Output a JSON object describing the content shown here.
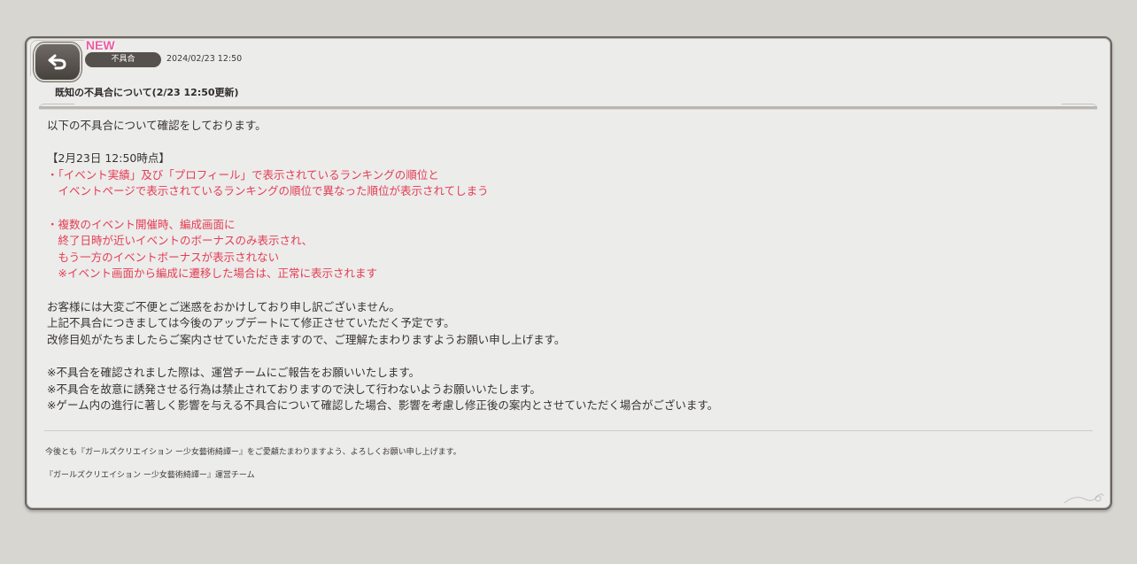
{
  "header": {
    "new_label": "NEW",
    "category": "不具合",
    "date": "2024/02/23 12:50",
    "title": "既知の不具合について(2/23 12:50更新)"
  },
  "icons": {
    "back": "back-arrow-icon"
  },
  "colors": {
    "accent_red": "#e33d52",
    "new_pink": "#ec5aa1",
    "pill_bg": "#56514d"
  },
  "body": {
    "intro": "以下の不具合について確認をしております。",
    "section_heading": "【2月23日 12:50時点】",
    "issue1_line1": "・「イベント実績」及び「プロフィール」で表示されているランキングの順位と",
    "issue1_line2": "　イベントページで表示されているランキングの順位で異なった順位が表示されてしまう",
    "issue2_line1": "・複数のイベント開催時、編成画面に",
    "issue2_line2": "　終了日時が近いイベントのボーナスのみ表示され、",
    "issue2_line3": "　もう一方のイベントボーナスが表示されない",
    "issue2_line4": "　※イベント画面から編成に遷移した場合は、正常に表示されます",
    "apology1": "お客様には大変ご不便とご迷惑をおかけしており申し訳ございません。",
    "apology2": "上記不具合につきましては今後のアップデートにて修正させていただく予定です。",
    "apology3": "改修目処がたちましたらご案内させていただきますので、ご理解たまわりますようお願い申し上げます。",
    "note1": "※不具合を確認されました際は、運営チームにご報告をお願いいたします。",
    "note2": "※不具合を故意に誘発させる行為は禁止されておりますので決して行わないようお願いいたします。",
    "note3": "※ゲーム内の進行に著しく影響を与える不具合について確認した場合、影響を考慮し修正後の案内とさせていただく場合がございます。"
  },
  "footer": {
    "closing": "今後とも『ガールズクリエイション ー少女藝術綺譚ー』をご愛顧たまわりますよう、よろしくお願い申し上げます。",
    "signature": "『ガールズクリエイション ー少女藝術綺譚ー』運営チーム"
  }
}
